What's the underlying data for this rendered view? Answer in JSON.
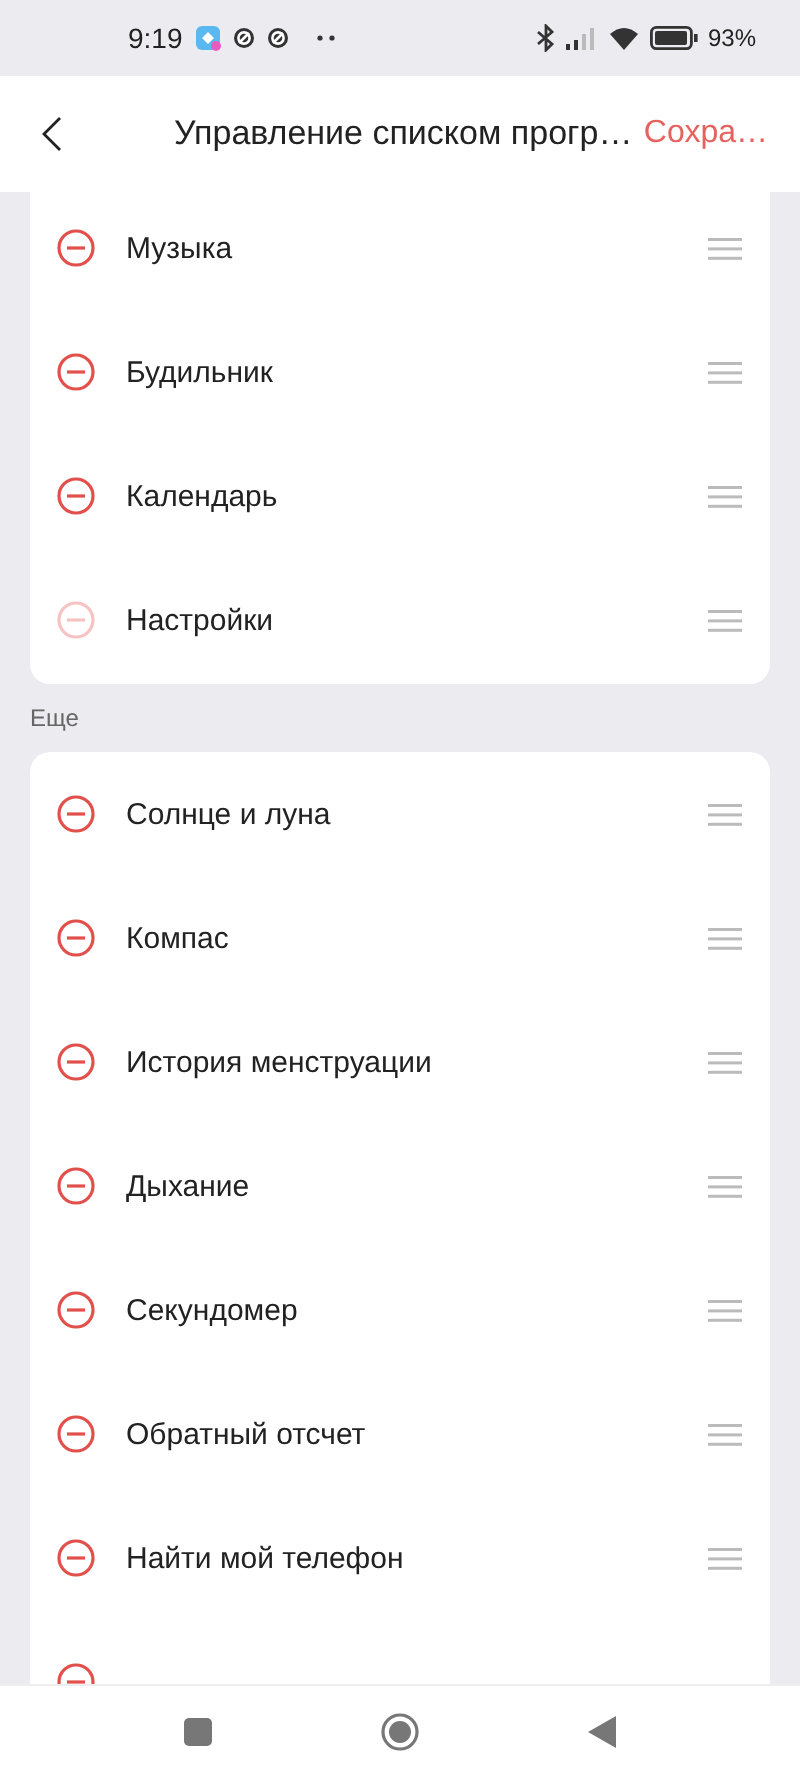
{
  "status_bar": {
    "time": "9:19",
    "battery": "93%"
  },
  "header": {
    "title": "Управление списком прогр…",
    "save": "Сохра…"
  },
  "visible_apps": [
    {
      "label": "Музыка",
      "disabled": false
    },
    {
      "label": "Будильник",
      "disabled": false
    },
    {
      "label": "Календарь",
      "disabled": false
    },
    {
      "label": "Настройки",
      "disabled": true
    }
  ],
  "more_section": {
    "title": "Еще",
    "apps": [
      {
        "label": "Солнце и луна",
        "disabled": false
      },
      {
        "label": "Компас",
        "disabled": false
      },
      {
        "label": "История менструации",
        "disabled": false
      },
      {
        "label": "Дыхание",
        "disabled": false
      },
      {
        "label": "Секундомер",
        "disabled": false
      },
      {
        "label": "Обратный отсчет",
        "disabled": false
      },
      {
        "label": "Найти мой телефон",
        "disabled": false
      }
    ]
  }
}
